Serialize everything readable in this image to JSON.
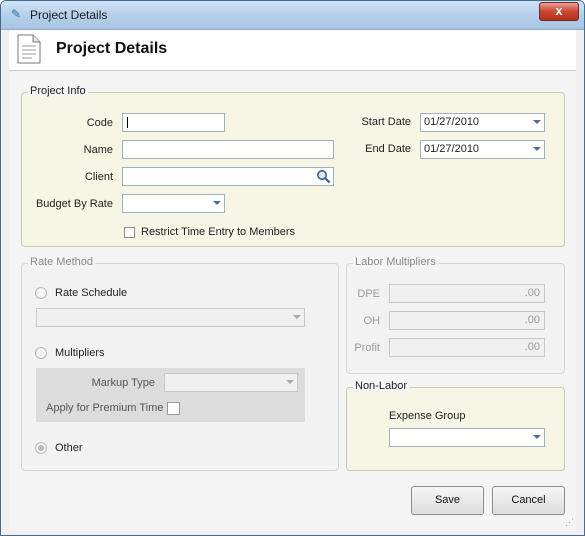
{
  "window": {
    "title": "Project Details",
    "close_label": "x"
  },
  "header": {
    "title": "Project Details"
  },
  "project_info": {
    "legend": "Project Info",
    "code_label": "Code",
    "code_value": "",
    "name_label": "Name",
    "name_value": "",
    "client_label": "Client",
    "client_value": "",
    "budget_label": "Budget By Rate",
    "budget_value": "",
    "start_label": "Start Date",
    "start_value": "01/27/2010",
    "end_label": "End Date",
    "end_value": "01/27/2010",
    "restrict_label": "Restrict Time Entry to Members"
  },
  "rate_method": {
    "legend": "Rate Method",
    "rate_schedule_label": "Rate Schedule",
    "rate_schedule_value": "",
    "multipliers_label": "Multipliers",
    "markup_label": "Markup Type",
    "markup_value": "",
    "premium_label": "Apply for Premium Time",
    "other_label": "Other"
  },
  "labor_multipliers": {
    "legend": "Labor Multipliers",
    "dpe_label": "DPE",
    "dpe_value": ".00",
    "oh_label": "OH",
    "oh_value": ".00",
    "profit_label": "Profit",
    "profit_value": ".00"
  },
  "non_labor": {
    "legend": "Non-Labor",
    "expense_label": "Expense Group",
    "expense_value": ""
  },
  "buttons": {
    "save": "Save",
    "cancel": "Cancel"
  }
}
